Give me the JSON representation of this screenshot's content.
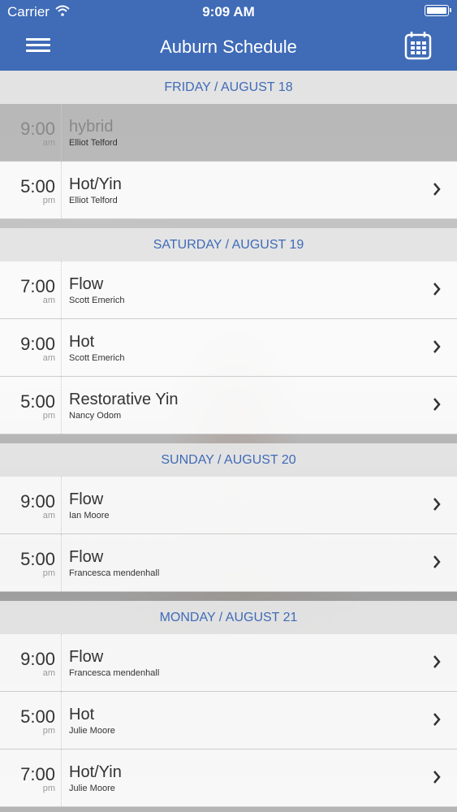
{
  "status_bar": {
    "carrier": "Carrier",
    "time": "9:09 AM"
  },
  "nav": {
    "title": "Auburn Schedule",
    "menu_icon": "hamburger-menu-icon",
    "calendar_icon": "calendar-icon"
  },
  "days": [
    {
      "label": "FRIDAY / AUGUST 18",
      "classes": [
        {
          "time": "9:00",
          "ampm": "am",
          "name": "hybrid",
          "instructor": "Elliot Telford",
          "past": true
        },
        {
          "time": "5:00",
          "ampm": "pm",
          "name": "Hot/Yin",
          "instructor": "Elliot Telford",
          "past": false
        }
      ]
    },
    {
      "label": "SATURDAY / AUGUST 19",
      "classes": [
        {
          "time": "7:00",
          "ampm": "am",
          "name": "Flow",
          "instructor": "Scott Emerich",
          "past": false
        },
        {
          "time": "9:00",
          "ampm": "am",
          "name": "Hot",
          "instructor": "Scott Emerich",
          "past": false
        },
        {
          "time": "5:00",
          "ampm": "pm",
          "name": "Restorative Yin",
          "instructor": "Nancy Odom",
          "past": false
        }
      ]
    },
    {
      "label": "SUNDAY / AUGUST 20",
      "classes": [
        {
          "time": "9:00",
          "ampm": "am",
          "name": "Flow",
          "instructor": "Ian Moore",
          "past": false
        },
        {
          "time": "5:00",
          "ampm": "pm",
          "name": "Flow",
          "instructor": "Francesca mendenhall",
          "past": false
        }
      ]
    },
    {
      "label": "MONDAY / AUGUST 21",
      "classes": [
        {
          "time": "9:00",
          "ampm": "am",
          "name": "Flow",
          "instructor": "Francesca mendenhall",
          "past": false
        },
        {
          "time": "5:00",
          "ampm": "pm",
          "name": "Hot",
          "instructor": "Julie Moore",
          "past": false
        },
        {
          "time": "7:00",
          "ampm": "pm",
          "name": "Hot/Yin",
          "instructor": "Julie Moore",
          "past": false
        }
      ]
    }
  ],
  "colors": {
    "accent": "#3f6bb7"
  }
}
